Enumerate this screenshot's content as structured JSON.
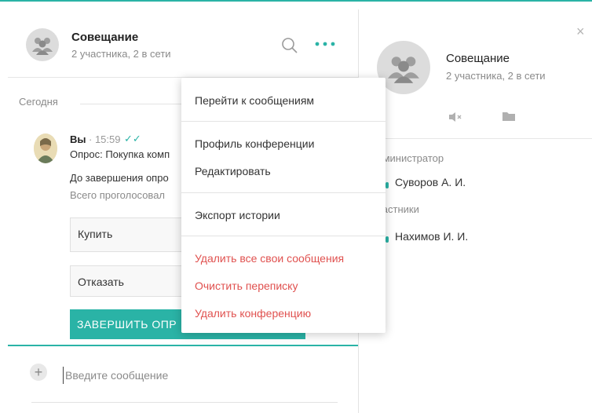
{
  "chat": {
    "title": "Совещание",
    "subtitle": "2 участника, 2 в сети",
    "day_label": "Сегодня",
    "message": {
      "author": "Вы",
      "time": "· 15:59",
      "read_mark": "✓✓",
      "poll_title": "Опрос: Покупка комп",
      "deadline_text": "До завершения опро",
      "voted_text": "Всего проголосовал",
      "options": [
        "Купить",
        "Отказать"
      ],
      "finish_label": "ЗАВЕРШИТЬ ОПР"
    },
    "composer": {
      "plus": "+",
      "placeholder": "Введите сообщение"
    }
  },
  "menu": {
    "items": [
      "Перейти к сообщениям",
      "Профиль конференции",
      "Редактировать",
      "Экспорт истории",
      "Удалить все свои сообщения",
      "Очистить переписку",
      "Удалить конференцию"
    ]
  },
  "info": {
    "close": "×",
    "title": "Совещание",
    "subtitle": "2 участника, 2 в сети",
    "admin_label": "дминистратор",
    "admin_name": "Суворов А. И.",
    "members_label": "частники",
    "member_name": "Нахимов И. И."
  },
  "colors": {
    "accent": "#2ab3a6",
    "danger": "#e0514f"
  },
  "icons": {
    "group": "group-icon",
    "search": "search-icon",
    "more": "more-icon",
    "mute": "mute-icon",
    "folder": "folder-icon"
  }
}
